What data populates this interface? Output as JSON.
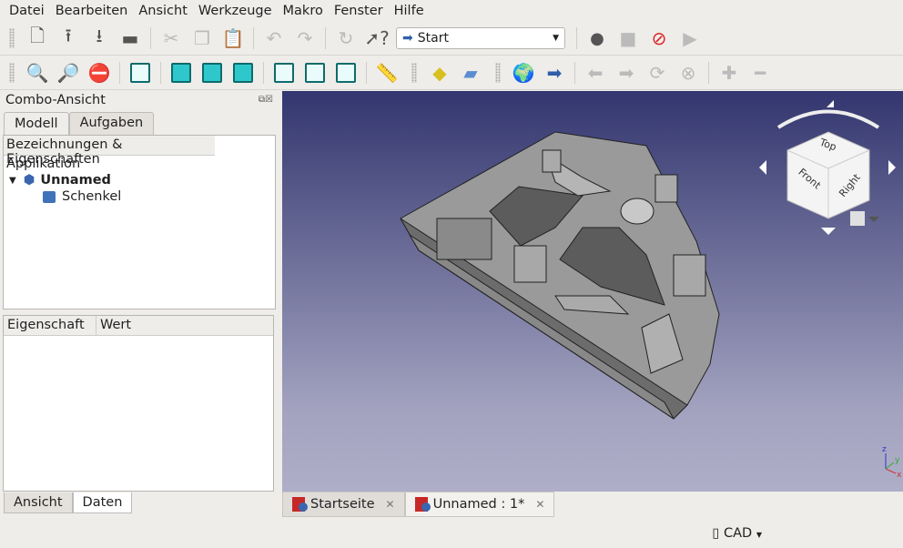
{
  "menu": [
    "Datei",
    "Bearbeiten",
    "Ansicht",
    "Werkzeuge",
    "Makro",
    "Fenster",
    "Hilfe"
  ],
  "toolbar": {
    "workbench": "Start"
  },
  "combo": {
    "title": "Combo-Ansicht",
    "tabs": [
      "Modell",
      "Aufgaben"
    ],
    "tree_header": "Bezeichnungen & Eigenschaften",
    "app_label": "Applikation",
    "document": "Unnamed",
    "object": "Schenkel",
    "prop_headers": [
      "Eigenschaft",
      "Wert"
    ],
    "bottom_tabs": [
      "Ansicht",
      "Daten"
    ]
  },
  "navcube": {
    "top": "Top",
    "front": "Front",
    "right": "Right"
  },
  "doc_tabs": [
    "Startseite",
    "Unnamed : 1*"
  ],
  "status": {
    "nav_style": "CAD"
  },
  "colors": {
    "viewport_top": "#33366f",
    "viewport_bottom": "#aeaec8",
    "cube_icon": "#2ec8cc"
  }
}
